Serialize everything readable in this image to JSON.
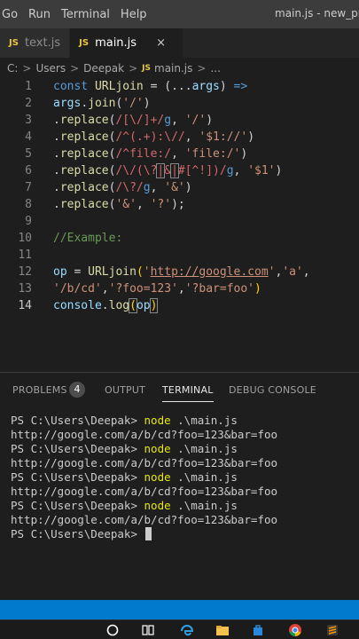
{
  "menu": {
    "items": [
      "Go",
      "Run",
      "Terminal",
      "Help"
    ],
    "window_title": "main.js - new_pro"
  },
  "tabs": [
    {
      "icon": "JS",
      "label": "text.js",
      "active": false
    },
    {
      "icon": "JS",
      "label": "main.js",
      "active": true,
      "close": "×"
    }
  ],
  "breadcrumb": {
    "parts": [
      "C:",
      "Users",
      "Deepak"
    ],
    "file_icon": "JS",
    "file": "main.js",
    "tail": "...",
    "separator": ">"
  },
  "editor": {
    "line_numbers": [
      "1",
      "2",
      "3",
      "4",
      "5",
      "6",
      "7",
      "8",
      "9",
      "10",
      "11",
      "12",
      "13",
      "14"
    ],
    "current_line": "14"
  },
  "panel": {
    "tabs": [
      "PROBLEMS",
      "OUTPUT",
      "TERMINAL",
      "DEBUG CONSOLE"
    ],
    "problems_count": "4",
    "active_tab": "TERMINAL"
  },
  "terminal": {
    "prompt": "PS C:\\Users\\Deepak> ",
    "command": "node",
    "command_args": " .\\main.js",
    "output": "http://google.com/a/b/cd?foo=123&bar=foo"
  },
  "colors": {
    "status_bar": "#007acc",
    "editor_bg": "#1e1e1e",
    "keyword": "#569cd6",
    "string": "#ce9178",
    "regex": "#d16969",
    "comment": "#6a9955"
  }
}
